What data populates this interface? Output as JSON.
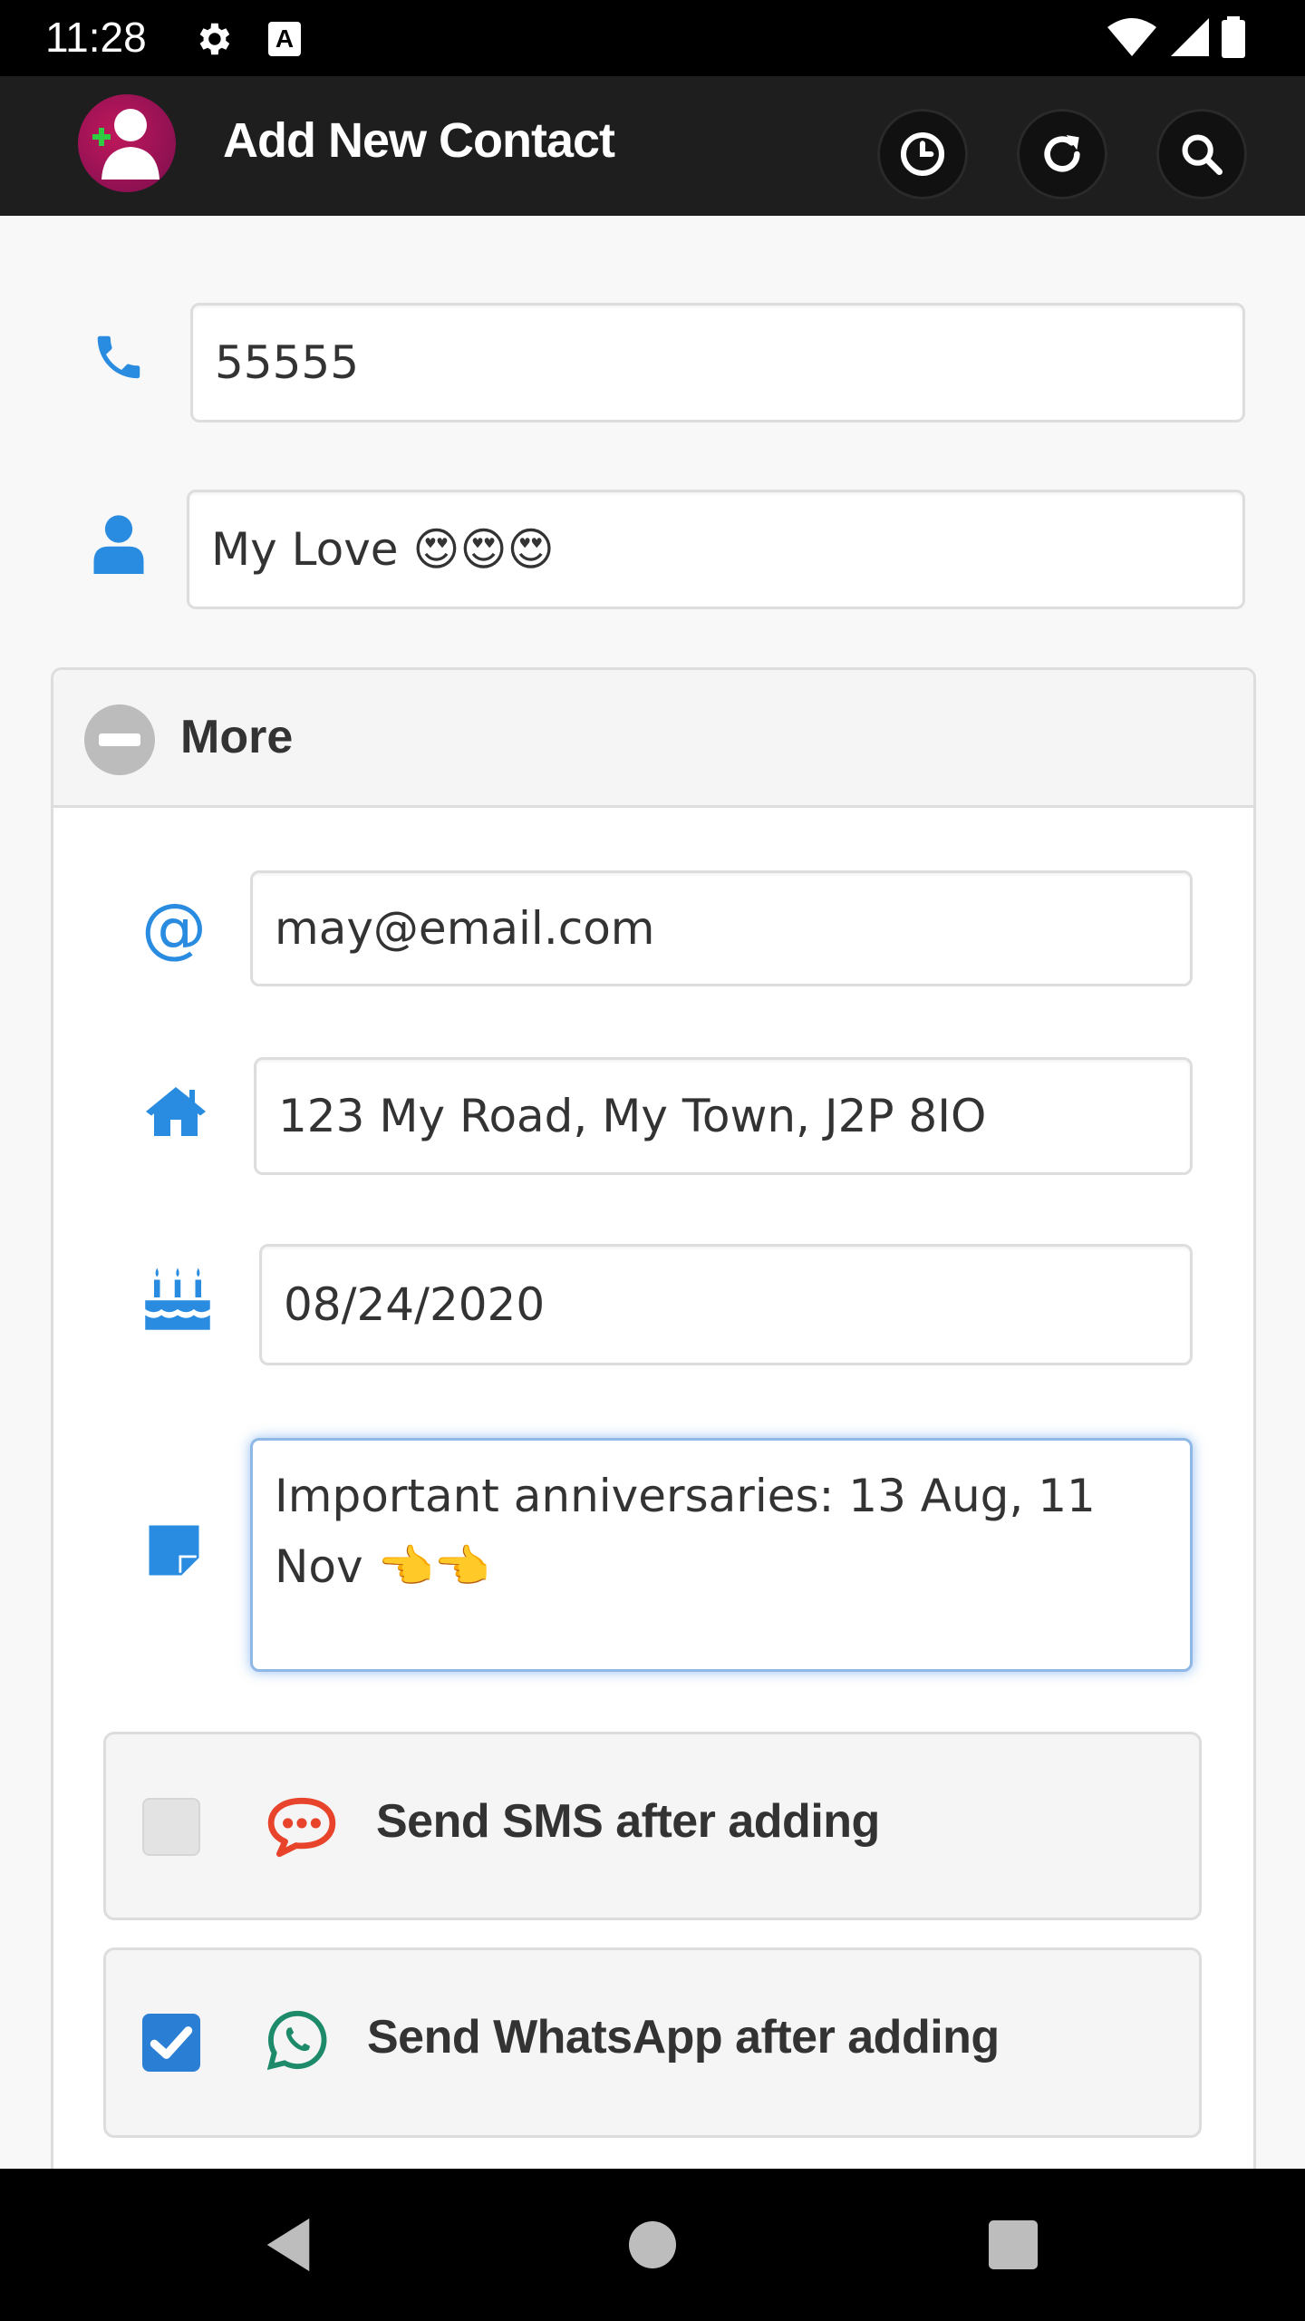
{
  "status_bar": {
    "time": "11:28",
    "icons": [
      "gear-icon",
      "a-icon",
      "wifi-icon",
      "signal-icon",
      "battery-icon"
    ]
  },
  "app_bar": {
    "title": "Add New Contact",
    "actions": [
      "history-icon",
      "refresh-icon",
      "search-icon"
    ]
  },
  "form": {
    "phone": {
      "value": "55555",
      "icon": "phone-icon"
    },
    "name": {
      "value": "My Love 😍😍😍",
      "icon": "person-icon"
    },
    "more": {
      "title": "More",
      "email": {
        "value": "may@email.com",
        "icon": "at-icon"
      },
      "address": {
        "value": "123 My Road, My Town, J2P 8IO",
        "icon": "home-icon"
      },
      "birthday": {
        "value": "08/24/2020",
        "icon": "birthday-cake-icon"
      },
      "notes": {
        "value": "Important anniversaries: 13 Aug, 11 Nov 👈👈",
        "icon": "note-icon"
      }
    },
    "send_sms": {
      "label": "Send SMS after adding",
      "checked": false,
      "icon": "sms-icon"
    },
    "send_whatsapp": {
      "label": "Send WhatsApp after adding",
      "checked": true,
      "icon": "whatsapp-icon"
    }
  },
  "colors": {
    "accent_blue": "#2a8ce0",
    "app_bar_bg": "#1e1e1e",
    "sms_red": "#e8442c",
    "whatsapp_green": "#1d8a6a",
    "checkbox_blue": "#2a7fd4"
  },
  "nav_bar": {
    "buttons": [
      "back-icon",
      "home-circle-icon",
      "recents-icon"
    ]
  }
}
